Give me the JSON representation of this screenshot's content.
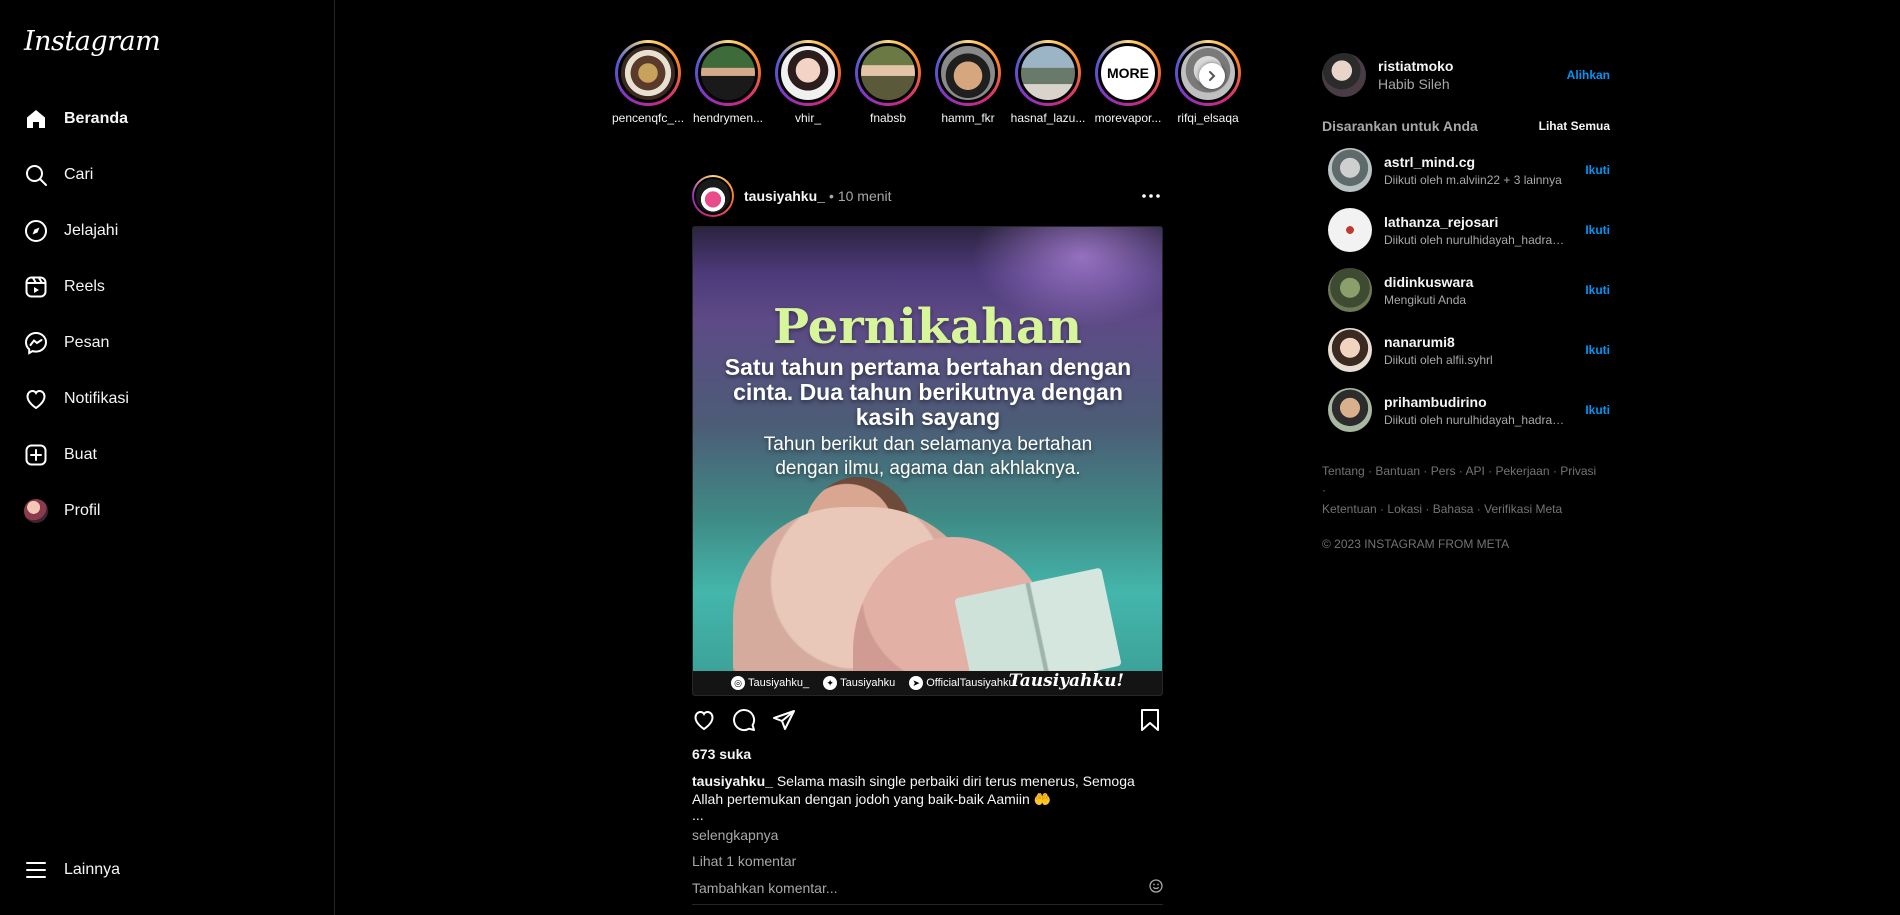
{
  "sidebar": {
    "logo": "Instagram",
    "items": [
      {
        "label": "Beranda",
        "icon": "home-icon"
      },
      {
        "label": "Cari",
        "icon": "search-icon"
      },
      {
        "label": "Jelajahi",
        "icon": "compass-icon"
      },
      {
        "label": "Reels",
        "icon": "reels-icon"
      },
      {
        "label": "Pesan",
        "icon": "messenger-icon"
      },
      {
        "label": "Notifikasi",
        "icon": "heart-icon"
      },
      {
        "label": "Buat",
        "icon": "plus-square-icon"
      },
      {
        "label": "Profil",
        "icon": "avatar"
      }
    ],
    "more_label": "Lainnya"
  },
  "stories": [
    {
      "name": "pencenqfc_..."
    },
    {
      "name": "hendrymen..."
    },
    {
      "name": "vhir_"
    },
    {
      "name": "fnabsb"
    },
    {
      "name": "hamm_fkr"
    },
    {
      "name": "hasnaf_lazu..."
    },
    {
      "name": "morevapor...",
      "avatar_text": "MORE"
    },
    {
      "name": "rifqi_elsaqa"
    }
  ],
  "post": {
    "username": "tausiyahku_",
    "separator": "•",
    "time": "10 menit",
    "image": {
      "title": "Pernikahan",
      "subtitle": "Satu tahun pertama bertahan dengan cinta. Dua tahun berikutnya dengan kasih sayang",
      "subtitle2": "Tahun berikut dan selamanya bertahan dengan ilmu, agama dan akhlaknya.",
      "footer_instagram": "Tausiyahku_",
      "footer_twitter": "Tausiyahku",
      "footer_telegram": "OfficialTausiyahku",
      "signature": "Tausiyahku!"
    },
    "likes": "673 suka",
    "caption_user": "tausiyahku_",
    "caption_text": " Selama masih single perbaiki diri terus menerus, Semoga Allah pertemukan dengan jodoh yang baik-baik Aamiin 🤲",
    "caption_ellipsis": "...",
    "more": "selengkapnya",
    "view_comments": "Lihat 1 komentar",
    "add_comment_placeholder": "Tambahkan komentar..."
  },
  "right": {
    "me": {
      "username": "ristiatmoko",
      "name": "Habib Sileh",
      "switch_label": "Alihkan"
    },
    "suggest_title": "Disarankan untuk Anda",
    "see_all": "Lihat Semua",
    "suggestions": [
      {
        "username": "astrl_mind.cg",
        "sub": "Diikuti oleh m.alviin22 + 3 lainnya",
        "follow": "Ikuti"
      },
      {
        "username": "lathanza_rejosari",
        "sub": "Diikuti oleh nurulhidayah_hadrah ...",
        "follow": "Ikuti"
      },
      {
        "username": "didinkuswara",
        "sub": "Mengikuti Anda",
        "follow": "Ikuti"
      },
      {
        "username": "nanarumi8",
        "sub": "Diikuti oleh alfii.syhrl",
        "follow": "Ikuti"
      },
      {
        "username": "prihambudirino",
        "sub": "Diikuti oleh nurulhidayah_hadrah ...",
        "follow": "Ikuti"
      }
    ],
    "footer_links": [
      "Tentang",
      "Bantuan",
      "Pers",
      "API",
      "Pekerjaan",
      "Privasi",
      "Ketentuan",
      "Lokasi",
      "Bahasa",
      "Verifikasi Meta"
    ],
    "footer_separator": " · ",
    "copyright": "© 2023 INSTAGRAM FROM META"
  },
  "colors": {
    "accent": "#0095f6",
    "background": "#000000",
    "muted": "#a8a8a8"
  }
}
